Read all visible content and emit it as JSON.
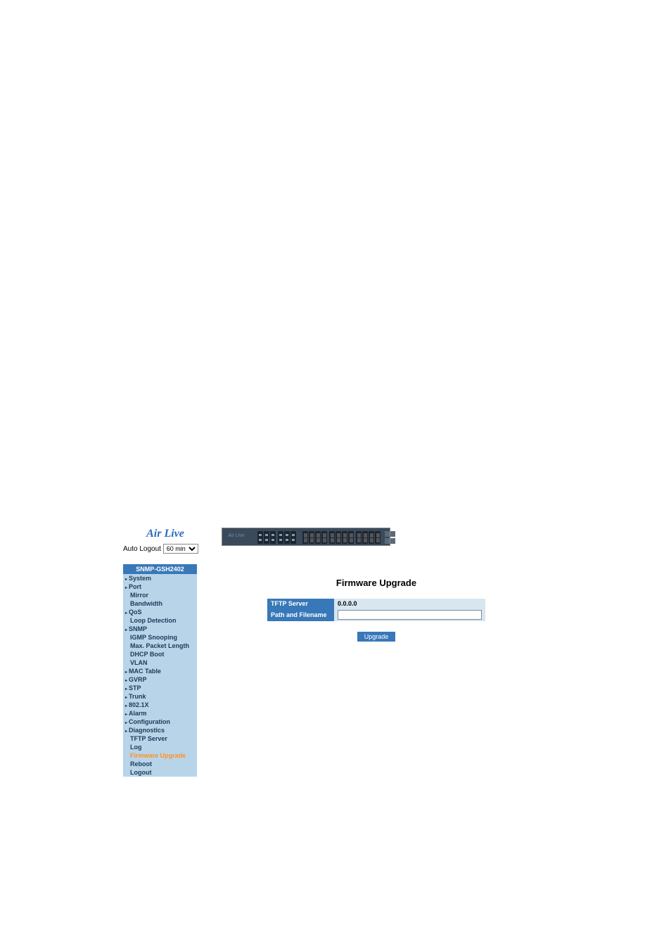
{
  "logo": {
    "brand": "Air Live",
    "tagline": ""
  },
  "auto_logout": {
    "label": "Auto Logout",
    "selected": "60 min"
  },
  "nav": {
    "header": "SNMP-GSH2402",
    "items": [
      {
        "label": "System",
        "expandable": true
      },
      {
        "label": "Port",
        "expandable": true
      },
      {
        "label": "Mirror",
        "expandable": false
      },
      {
        "label": "Bandwidth",
        "expandable": false
      },
      {
        "label": "QoS",
        "expandable": true
      },
      {
        "label": "Loop Detection",
        "expandable": false
      },
      {
        "label": "SNMP",
        "expandable": true
      },
      {
        "label": "IGMP Snooping",
        "expandable": false
      },
      {
        "label": "Max. Packet Length",
        "expandable": false
      },
      {
        "label": "DHCP Boot",
        "expandable": false
      },
      {
        "label": "VLAN",
        "expandable": false
      },
      {
        "label": "MAC Table",
        "expandable": true
      },
      {
        "label": "GVRP",
        "expandable": true
      },
      {
        "label": "STP",
        "expandable": true
      },
      {
        "label": "Trunk",
        "expandable": true
      },
      {
        "label": "802.1X",
        "expandable": true
      },
      {
        "label": "Alarm",
        "expandable": true
      },
      {
        "label": "Configuration",
        "expandable": true
      },
      {
        "label": "Diagnostics",
        "expandable": true
      },
      {
        "label": "TFTP Server",
        "expandable": false
      },
      {
        "label": "Log",
        "expandable": false
      },
      {
        "label": "Firmware Upgrade",
        "expandable": false,
        "active": true
      },
      {
        "label": "Reboot",
        "expandable": false
      },
      {
        "label": "Logout",
        "expandable": false
      }
    ]
  },
  "page": {
    "title": "Firmware Upgrade"
  },
  "form": {
    "tftp_label": "TFTP Server",
    "tftp_value": "0.0.0.0",
    "path_label": "Path and Filename",
    "path_value": ""
  },
  "buttons": {
    "upgrade": "Upgrade"
  },
  "switch_brand": "Air Live"
}
